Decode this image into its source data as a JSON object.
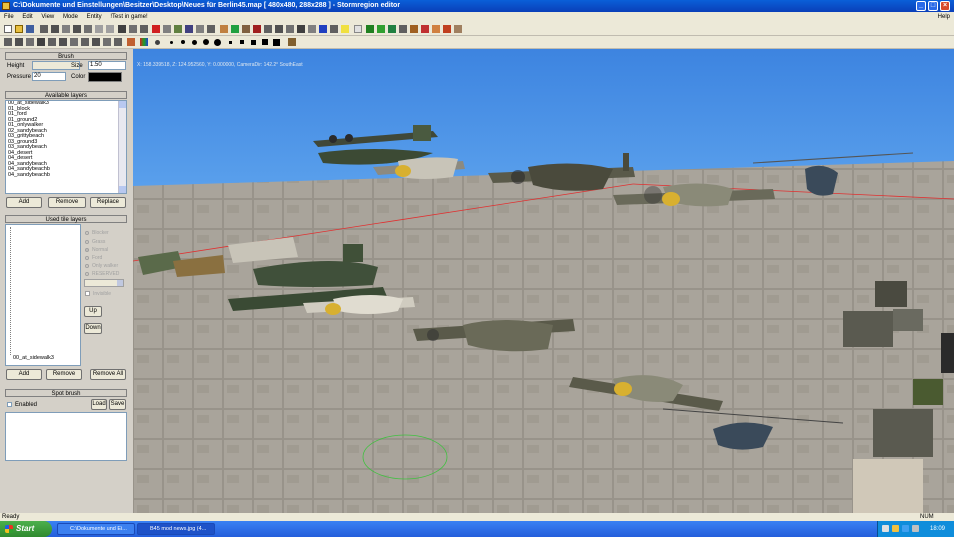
{
  "window": {
    "title": "C:\\Dokumente und Einstellungen\\Besitzer\\Desktop\\Neues für Berlin45.map [ 480x480, 288x288 ] - Stormregion editor"
  },
  "menu": {
    "items": [
      "File",
      "Edit",
      "View",
      "Mode",
      "Entity",
      "!Test in game!"
    ],
    "help": "Help"
  },
  "brush": {
    "header": "Brush",
    "height_label": "Height",
    "height_value": "",
    "size_label": "Size",
    "size_value": "1.50",
    "pressure_label": "Pressure",
    "pressure_value": "20",
    "color_label": "Color",
    "color_value": "#000000"
  },
  "available_layers": {
    "header": "Available layers",
    "items": [
      "00_at_sidewalk3",
      "01_block",
      "01_ford",
      "01_ground2",
      "01_onlywalker",
      "02_sandybeach",
      "03_grittybeach",
      "03_ground3",
      "03_sandybeach",
      "04_desert",
      "04_desert",
      "04_sandybeach",
      "04_sandybeachb",
      "04_sandybeachb"
    ],
    "add": "Add",
    "remove": "Remove",
    "replace": "Replace"
  },
  "used_tile_layers": {
    "header": "Used tile layers",
    "bottom_item": "00_at_sidewalk3",
    "radios": [
      "Blocker",
      "Grass",
      "Normal",
      "Ford",
      "Only walker",
      "RESERVED"
    ],
    "invisible_label": "Invisible",
    "up": "Up",
    "down": "Down",
    "add": "Add",
    "remove": "Remove",
    "remove_all": "Remove All"
  },
  "spot_brush": {
    "header": "Spot brush",
    "enabled_label": "Enabled",
    "load": "Load",
    "save": "Save"
  },
  "viewport": {
    "coords": "X: 158.339518, Z: 124.952560, Y: 0.000000, CameraDir: 142.2° SouthEast"
  },
  "status": {
    "text": "Ready",
    "num": "NUM"
  },
  "taskbar": {
    "start": "Start",
    "tasks": [
      "C:\\Dokumente und Ei...",
      "B45 mod news.jpg (4..."
    ],
    "time": "18:09"
  }
}
